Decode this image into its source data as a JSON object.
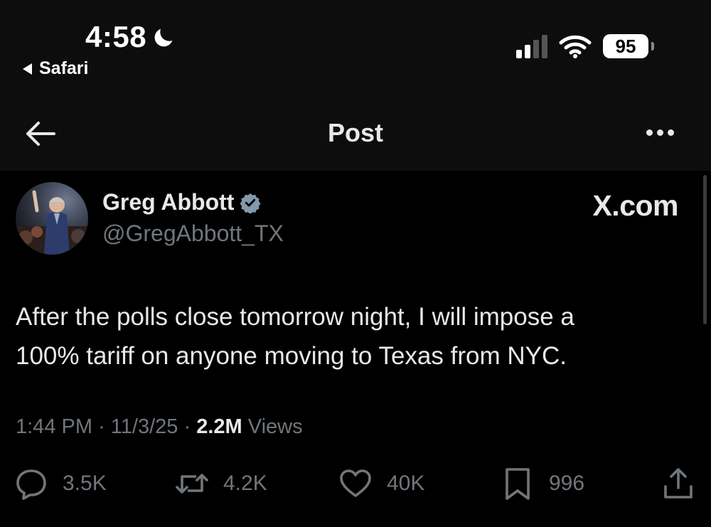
{
  "status_bar": {
    "time": "4:58",
    "back_app": "Safari",
    "battery": "95"
  },
  "nav": {
    "title": "Post"
  },
  "post": {
    "author_name": "Greg Abbott",
    "handle": "@GregAbbott_TX",
    "watermark": "X.com",
    "text_line1": "After the polls close tomorrow night, I will impose a",
    "text_line2": "100% tariff on anyone moving to Texas from NYC.",
    "time": "1:44 PM",
    "date": "11/3/25",
    "views_count": "2.2M",
    "views_label": "Views",
    "separator": "·"
  },
  "actions": {
    "replies": "3.5K",
    "reposts": "4.2K",
    "likes": "40K",
    "bookmarks": "996"
  },
  "colors": {
    "background": "#000000",
    "header_background": "#0d0d0d",
    "text_primary": "#e7e9ea",
    "text_secondary": "#71767b",
    "verified_badge": "#829aab"
  }
}
